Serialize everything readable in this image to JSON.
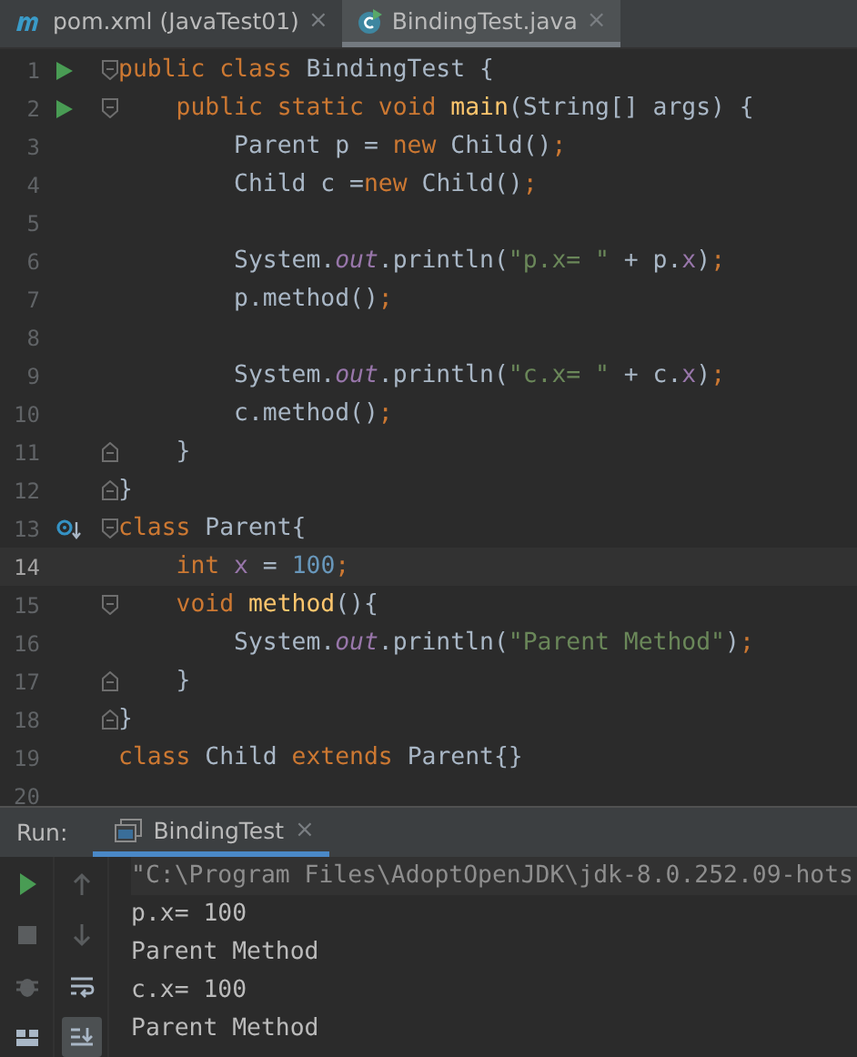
{
  "tabs": [
    {
      "label": "pom.xml (JavaTest01)",
      "kind": "maven",
      "selected": false,
      "close": "×"
    },
    {
      "label": "BindingTest.java",
      "kind": "class",
      "selected": true,
      "close": "×"
    }
  ],
  "code_lines": [
    {
      "number": "1",
      "runnable": true,
      "overridden": false,
      "fold_start": true,
      "fold_end": false,
      "current": false,
      "tokens": [
        {
          "kind": "keyword",
          "text": "public class "
        },
        {
          "kind": "plain",
          "text": "BindingTest {"
        }
      ]
    },
    {
      "number": "2",
      "runnable": true,
      "overridden": false,
      "fold_start": true,
      "fold_end": false,
      "current": false,
      "tokens": [
        {
          "kind": "keyword",
          "text": "    public static void "
        },
        {
          "kind": "method",
          "text": "main"
        },
        {
          "kind": "plain",
          "text": "(String[] args) {"
        }
      ]
    },
    {
      "number": "3",
      "runnable": false,
      "overridden": false,
      "fold_start": false,
      "fold_end": false,
      "current": false,
      "tokens": [
        {
          "kind": "plain",
          "text": "        Parent p = "
        },
        {
          "kind": "keyword",
          "text": "new "
        },
        {
          "kind": "plain",
          "text": "Child()"
        },
        {
          "kind": "keyword",
          "text": ";"
        }
      ]
    },
    {
      "number": "4",
      "runnable": false,
      "overridden": false,
      "fold_start": false,
      "fold_end": false,
      "current": false,
      "tokens": [
        {
          "kind": "plain",
          "text": "        Child c ="
        },
        {
          "kind": "keyword",
          "text": "new "
        },
        {
          "kind": "plain",
          "text": "Child()"
        },
        {
          "kind": "keyword",
          "text": ";"
        }
      ]
    },
    {
      "number": "5",
      "runnable": false,
      "overridden": false,
      "fold_start": false,
      "fold_end": false,
      "current": false
    },
    {
      "number": "6",
      "runnable": false,
      "overridden": false,
      "fold_start": false,
      "fold_end": false,
      "current": false,
      "tokens": [
        {
          "kind": "plain",
          "text": "        System."
        },
        {
          "kind": "static",
          "text": "out"
        },
        {
          "kind": "plain",
          "text": ".println("
        },
        {
          "kind": "string",
          "text": "\"p.x= \""
        },
        {
          "kind": "plain",
          "text": " + p."
        },
        {
          "kind": "field",
          "text": "x"
        },
        {
          "kind": "plain",
          "text": ")"
        },
        {
          "kind": "keyword",
          "text": ";"
        }
      ]
    },
    {
      "number": "7",
      "runnable": false,
      "overridden": false,
      "fold_start": false,
      "fold_end": false,
      "current": false,
      "tokens": [
        {
          "kind": "plain",
          "text": "        p.method()"
        },
        {
          "kind": "keyword",
          "text": ";"
        }
      ]
    },
    {
      "number": "8",
      "runnable": false,
      "overridden": false,
      "fold_start": false,
      "fold_end": false,
      "current": false
    },
    {
      "number": "9",
      "runnable": false,
      "overridden": false,
      "fold_start": false,
      "fold_end": false,
      "current": false,
      "tokens": [
        {
          "kind": "plain",
          "text": "        System."
        },
        {
          "kind": "static",
          "text": "out"
        },
        {
          "kind": "plain",
          "text": ".println("
        },
        {
          "kind": "string",
          "text": "\"c.x= \""
        },
        {
          "kind": "plain",
          "text": " + c."
        },
        {
          "kind": "field",
          "text": "x"
        },
        {
          "kind": "plain",
          "text": ")"
        },
        {
          "kind": "keyword",
          "text": ";"
        }
      ]
    },
    {
      "number": "10",
      "runnable": false,
      "overridden": false,
      "fold_start": false,
      "fold_end": false,
      "current": false,
      "tokens": [
        {
          "kind": "plain",
          "text": "        c.method()"
        },
        {
          "kind": "keyword",
          "text": ";"
        }
      ]
    },
    {
      "number": "11",
      "runnable": false,
      "overridden": false,
      "fold_start": false,
      "fold_end": true,
      "current": false,
      "tokens": [
        {
          "kind": "plain",
          "text": "    }"
        }
      ]
    },
    {
      "number": "12",
      "runnable": false,
      "overridden": false,
      "fold_start": false,
      "fold_end": true,
      "current": false,
      "tokens": [
        {
          "kind": "plain",
          "text": "}"
        }
      ]
    },
    {
      "number": "13",
      "runnable": false,
      "overridden": true,
      "fold_start": true,
      "fold_end": false,
      "current": false,
      "tokens": [
        {
          "kind": "keyword",
          "text": "class "
        },
        {
          "kind": "plain",
          "text": "Parent{"
        }
      ]
    },
    {
      "number": "14",
      "runnable": false,
      "overridden": false,
      "fold_start": false,
      "fold_end": false,
      "current": true,
      "tokens": [
        {
          "kind": "keyword",
          "text": "    int "
        },
        {
          "kind": "field",
          "text": "x"
        },
        {
          "kind": "plain",
          "text": " = "
        },
        {
          "kind": "number",
          "text": "100"
        },
        {
          "kind": "keyword",
          "text": ";"
        }
      ]
    },
    {
      "number": "15",
      "runnable": false,
      "overridden": false,
      "fold_start": true,
      "fold_end": false,
      "current": false,
      "tokens": [
        {
          "kind": "keyword",
          "text": "    void "
        },
        {
          "kind": "method",
          "text": "method"
        },
        {
          "kind": "plain",
          "text": "(){"
        }
      ]
    },
    {
      "number": "16",
      "runnable": false,
      "overridden": false,
      "fold_start": false,
      "fold_end": false,
      "current": false,
      "tokens": [
        {
          "kind": "plain",
          "text": "        System."
        },
        {
          "kind": "static",
          "text": "out"
        },
        {
          "kind": "plain",
          "text": ".println("
        },
        {
          "kind": "string",
          "text": "\"Parent Method\""
        },
        {
          "kind": "plain",
          "text": ")"
        },
        {
          "kind": "keyword",
          "text": ";"
        }
      ]
    },
    {
      "number": "17",
      "runnable": false,
      "overridden": false,
      "fold_start": false,
      "fold_end": true,
      "current": false,
      "tokens": [
        {
          "kind": "plain",
          "text": "    }"
        }
      ]
    },
    {
      "number": "18",
      "runnable": false,
      "overridden": false,
      "fold_start": false,
      "fold_end": true,
      "current": false,
      "tokens": [
        {
          "kind": "plain",
          "text": "}"
        }
      ]
    },
    {
      "number": "19",
      "runnable": false,
      "overridden": false,
      "fold_start": false,
      "fold_end": false,
      "current": false,
      "tokens": [
        {
          "kind": "keyword",
          "text": "class "
        },
        {
          "kind": "plain",
          "text": "Child "
        },
        {
          "kind": "keyword",
          "text": "extends "
        },
        {
          "kind": "plain",
          "text": "Parent{}"
        }
      ]
    },
    {
      "number": "20",
      "runnable": false,
      "overridden": false,
      "fold_start": false,
      "fold_end": false,
      "current": false
    }
  ],
  "run_panel": {
    "label": "Run:",
    "tabs": [
      {
        "label": "BindingTest",
        "selected": true,
        "close": "×"
      }
    ],
    "console": [
      {
        "kind": "command",
        "text": "\"C:\\Program Files\\AdoptOpenJDK\\jdk-8.0.252.09-hots"
      },
      {
        "kind": "output",
        "text": "p.x= 100"
      },
      {
        "kind": "output",
        "text": "Parent Method"
      },
      {
        "kind": "output",
        "text": "c.x= 100"
      },
      {
        "kind": "output",
        "text": "Parent Method"
      }
    ]
  }
}
